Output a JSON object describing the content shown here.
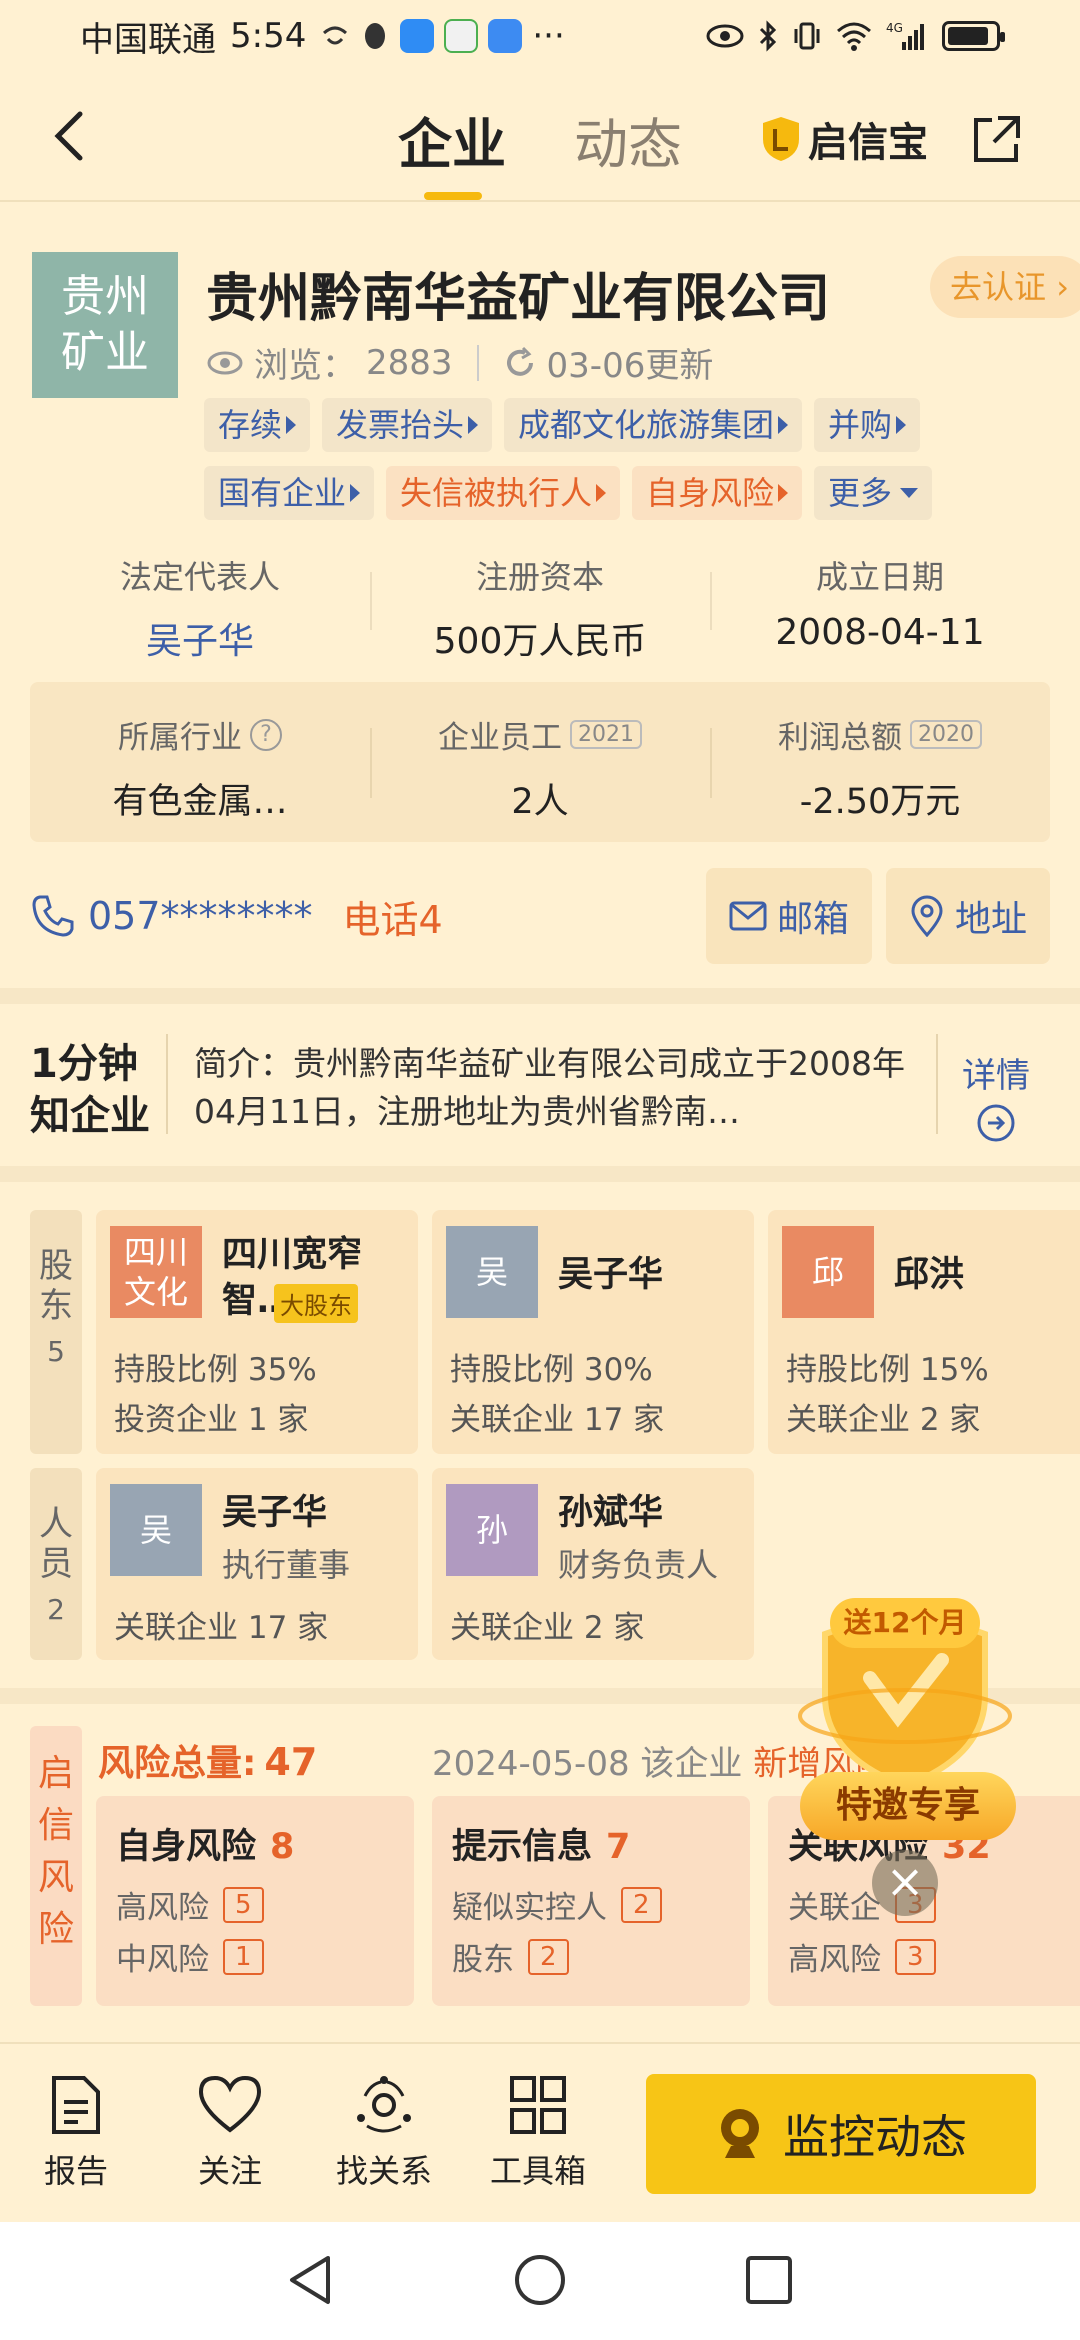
{
  "status_bar": {
    "carrier": "中国联通",
    "time": "5:54",
    "more": "···",
    "network": "4G"
  },
  "nav": {
    "tab_active": "企业",
    "tab_inactive": "动态",
    "brand": "启信宝"
  },
  "company": {
    "logo_text": "贵州矿业",
    "name": "贵州黔南华益矿业有限公司",
    "certify": "去认证",
    "views_label": "浏览：",
    "views": "2883",
    "updated": "03-06更新",
    "tags": [
      {
        "label": "存续",
        "tone": "blue"
      },
      {
        "label": "发票抬头",
        "tone": "blue"
      },
      {
        "label": "成都文化旅游集团",
        "tone": "blue"
      },
      {
        "label": "并购",
        "tone": "blue"
      },
      {
        "label": "国有企业",
        "tone": "blue"
      },
      {
        "label": "失信被执行人",
        "tone": "orange"
      },
      {
        "label": "自身风险",
        "tone": "orange"
      },
      {
        "label": "更多",
        "tone": "blue"
      }
    ],
    "legal_rep_label": "法定代表人",
    "legal_rep": "吴子华",
    "capital_label": "注册资本",
    "capital": "500万人民币",
    "founded_label": "成立日期",
    "founded": "2008-04-11",
    "industry_label": "所属行业",
    "industry": "有色金属…",
    "employees_label": "企业员工",
    "employees_year": "2021",
    "employees": "2人",
    "profit_label": "利润总额",
    "profit_year": "2020",
    "profit": "-2.50万元",
    "phone": "057********",
    "phone_count": "电话4",
    "mail_label": "邮箱",
    "address_label": "地址"
  },
  "intro": {
    "badge_line1": "1分钟",
    "badge_line2": "知企业",
    "text": "简介：贵州黔南华益矿业有限公司成立于2008年04月11日，注册地址为贵州省黔南…",
    "detail": "详情"
  },
  "shareholders": {
    "side_label": "股东",
    "count": "5",
    "items": [
      {
        "avatar": "四川文化",
        "avatar_color": "#E98A62",
        "name": "四川宽窄智…",
        "tag": "大股东",
        "line1": "持股比例 35%",
        "line2": "投资企业 1 家"
      },
      {
        "avatar": "吴",
        "avatar_color": "#98A5B3",
        "name": "吴子华",
        "line1": "持股比例 30%",
        "line2": "关联企业 17 家"
      },
      {
        "avatar": "邱",
        "avatar_color": "#E98A62",
        "name": "邱洪",
        "line1": "持股比例 15%",
        "line2": "关联企业 2 家"
      }
    ]
  },
  "people": {
    "side_label": "人员",
    "count": "2",
    "items": [
      {
        "avatar": "吴",
        "avatar_color": "#98A5B3",
        "name": "吴子华",
        "role": "执行董事",
        "line": "关联企业 17 家"
      },
      {
        "avatar": "孙",
        "avatar_color": "#B09AC0",
        "name": "孙斌华",
        "role": "财务负责人",
        "line": "关联企业 2 家"
      }
    ]
  },
  "risk": {
    "side_label": "启信风险",
    "total_label": "风险总量:",
    "total": "47",
    "date": "2024-05-08 该企业",
    "new_label": "新增风险",
    "cards": [
      {
        "title": "自身风险",
        "count": "8",
        "rows": [
          {
            "label": "高风险",
            "value": "5"
          },
          {
            "label": "中风险",
            "value": "1"
          }
        ]
      },
      {
        "title": "提示信息",
        "count": "7",
        "rows": [
          {
            "label": "疑似实控人",
            "value": "2"
          },
          {
            "label": "股东",
            "value": "2"
          }
        ]
      },
      {
        "title": "关联风险",
        "count": "32",
        "rows": [
          {
            "label": "关联企",
            "value": "3"
          },
          {
            "label": "高风险",
            "value": "3"
          }
        ]
      }
    ]
  },
  "promo": {
    "ribbon": "送12个月",
    "button": "特邀专享",
    "close": "×"
  },
  "bottom_bar": {
    "report": "报告",
    "follow": "关注",
    "relations": "找关系",
    "toolbox": "工具箱",
    "monitor": "监控动态"
  },
  "colors": {
    "background": "#FFF1D2",
    "accent_yellow": "#F7C516",
    "link_blue": "#3D5FA8",
    "risk_orange": "#E5632A"
  }
}
